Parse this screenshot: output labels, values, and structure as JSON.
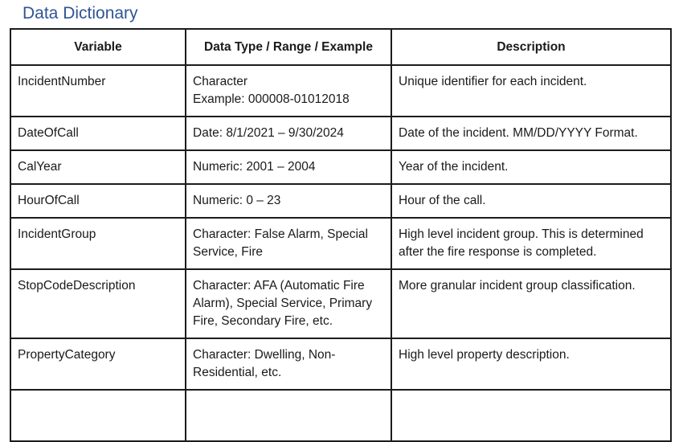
{
  "page": {
    "title": "Data Dictionary"
  },
  "table": {
    "headers": {
      "variable": "Variable",
      "type": "Data Type / Range / Example",
      "description": "Description"
    },
    "rows": [
      {
        "variable": "IncidentNumber",
        "type_lines": [
          "Character",
          "Example: 000008-01012018"
        ],
        "description_lines": [
          "Unique identifier for each incident."
        ]
      },
      {
        "variable": "DateOfCall",
        "type_lines": [
          "Date: 8/1/2021 – 9/30/2024"
        ],
        "description_lines": [
          "Date of the incident. MM/DD/YYYY Format."
        ]
      },
      {
        "variable": "CalYear",
        "type_lines": [
          "Numeric: 2001 – 2004"
        ],
        "description_lines": [
          "Year of the incident."
        ]
      },
      {
        "variable": "HourOfCall",
        "type_lines": [
          "Numeric: 0 – 23"
        ],
        "description_lines": [
          "Hour of the call."
        ]
      },
      {
        "variable": "IncidentGroup",
        "type_lines": [
          "Character: False Alarm, Special",
          "Service, Fire"
        ],
        "description_lines": [
          "High level incident group. This is determined",
          "after the fire response is completed."
        ]
      },
      {
        "variable": "StopCodeDescription",
        "type_lines": [
          "Character: AFA (Automatic Fire",
          "Alarm), Special Service, Primary",
          "Fire, Secondary Fire, etc."
        ],
        "description_lines": [
          "More granular incident group classification."
        ]
      },
      {
        "variable": "PropertyCategory",
        "type_lines": [
          "Character: Dwelling, Non-",
          "Residential, etc."
        ],
        "description_lines": [
          "High level property description."
        ]
      }
    ]
  }
}
